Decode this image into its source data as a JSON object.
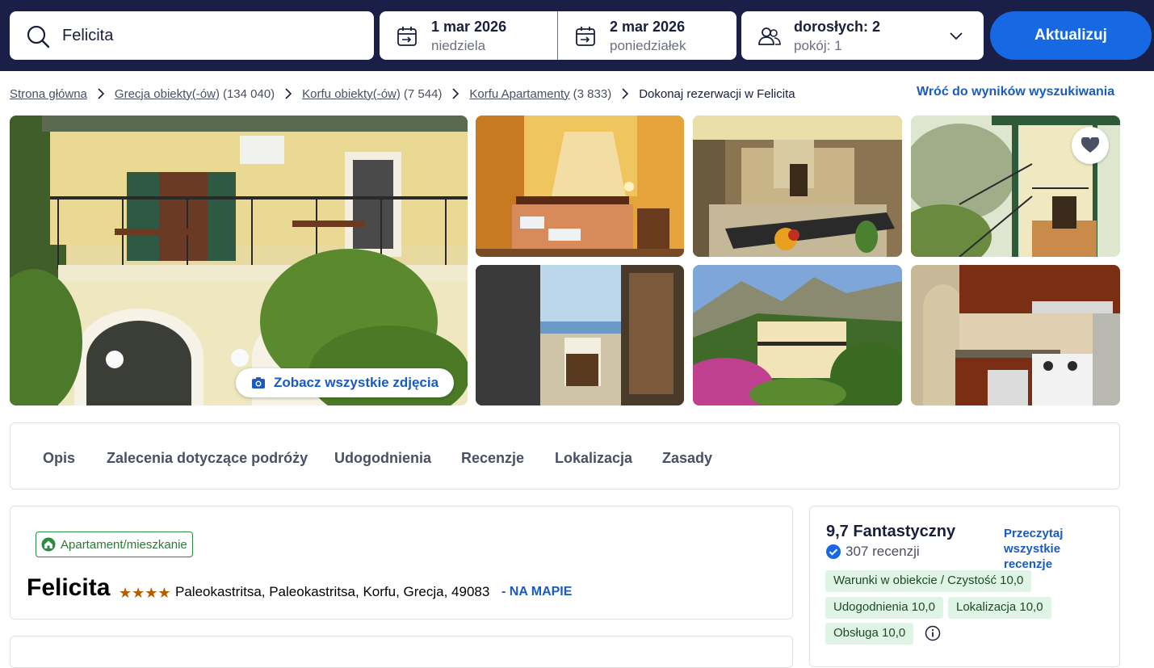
{
  "search": {
    "destination": "Felicita",
    "checkin_date": "1 mar 2026",
    "checkin_day": "niedziela",
    "checkout_date": "2 mar 2026",
    "checkout_day": "poniedziałek",
    "adults": "dorosłych: 2",
    "rooms": "pokój: 1",
    "update_label": "Aktualizuj"
  },
  "breadcrumb": {
    "items": [
      {
        "label": "Strona główna",
        "count": ""
      },
      {
        "label": "Grecja obiekty(-ów)",
        "count": "(134 040)"
      },
      {
        "label": "Korfu obiekty(-ów)",
        "count": "(7 544)"
      },
      {
        "label": "Korfu Apartamenty",
        "count": "(3 833)"
      }
    ],
    "current": "Dokonaj rezerwacji w Felicita",
    "back_label": "Wróć do wyników wyszukiwania"
  },
  "gallery": {
    "see_all_label": "Zobacz wszystkie zdjęcia"
  },
  "tabs": [
    "Opis",
    "Zalecenia dotyczące podróży",
    "Udogodnienia",
    "Recenzje",
    "Lokalizacja",
    "Zasady"
  ],
  "property": {
    "type_badge": "Apartament/mieszkanie",
    "name": "Felicita",
    "stars": "★★★★",
    "star_rating": 4,
    "address": "Paleokastritsa, Paleokastritsa, Korfu, Grecja, 49083",
    "map_link": "- NA MAPIE"
  },
  "rating": {
    "score_text": "9,7 Fantastyczny",
    "reviews_count": "307 recenzji",
    "read_all": "Przeczytaj wszystkie recenzje",
    "categories": [
      "Warunki w obiekcie / Czystość 10,0",
      "Udogodnienia 10,0",
      "Lokalizacja 10,0",
      "Obsługa 10,0"
    ]
  },
  "colors": {
    "header_bg": "#1a1f47",
    "primary_blue": "#1668e3",
    "link_blue": "#1a5bbf",
    "badge_green": "#2a8a3e",
    "pill_green": "#dff4e4",
    "star_orange": "#b35c00"
  }
}
